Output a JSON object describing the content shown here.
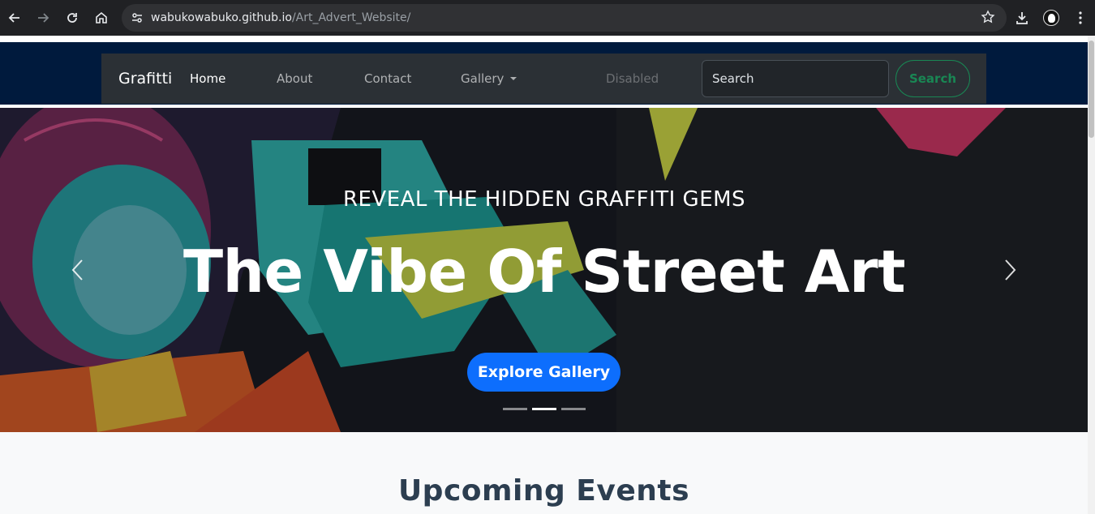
{
  "browser": {
    "url_host": "wabukowabuko.github.io",
    "url_path": "/Art_Advert_Website/",
    "icons": [
      "back-icon",
      "forward-icon",
      "reload-icon",
      "home-icon",
      "site-settings-icon",
      "bookmark-star-icon",
      "download-icon",
      "profile-avatar",
      "more-menu-icon"
    ]
  },
  "navbar": {
    "brand": "Grafitti",
    "links": [
      {
        "label": "Home",
        "state": "active"
      },
      {
        "label": "About",
        "state": "normal"
      },
      {
        "label": "Contact",
        "state": "normal"
      },
      {
        "label": "Gallery",
        "state": "dropdown"
      },
      {
        "label": "Disabled",
        "state": "disabled"
      }
    ],
    "search_placeholder": "Search",
    "search_button": "Search"
  },
  "hero": {
    "kicker": "REVEAL THE HIDDEN GRAFFITI GEMS",
    "title": "The Vibe Of Street Art",
    "cta": "Explore Gallery",
    "slides": 3,
    "active_slide": 2
  },
  "events": {
    "heading": "Upcoming Events"
  },
  "colors": {
    "header_band": "#001a3d",
    "navbar_bg": "#2b3035",
    "search_green": "#198754",
    "cta_blue": "#0d6efd",
    "heading": "#2c3e50"
  }
}
